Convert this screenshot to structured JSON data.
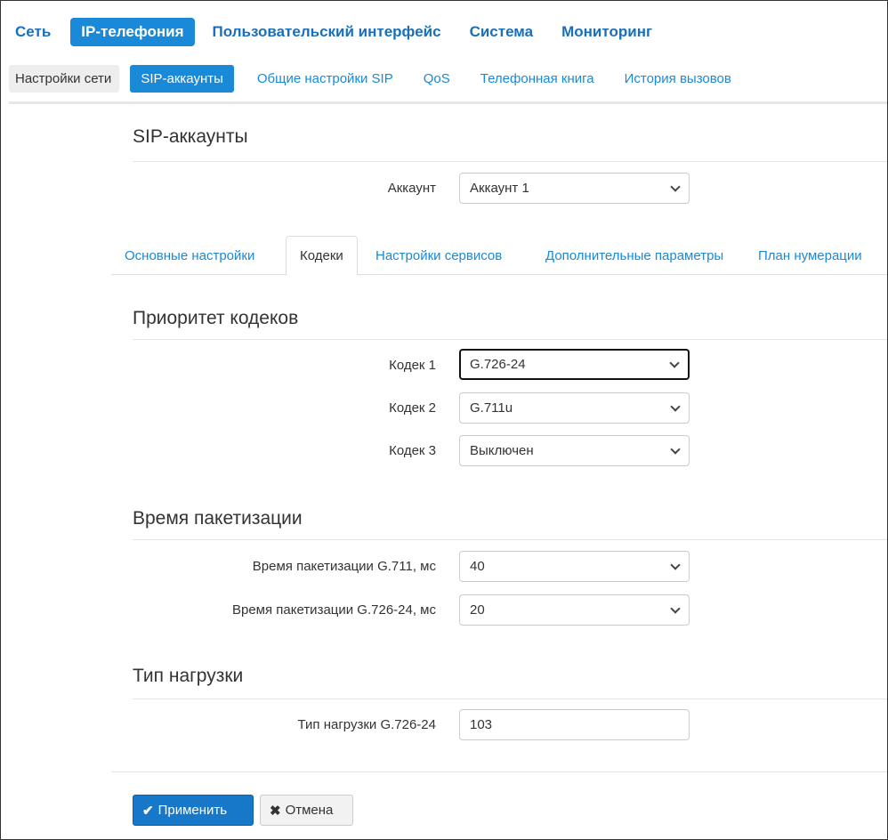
{
  "topnav": {
    "items": [
      {
        "label": "Сеть",
        "active": false
      },
      {
        "label": "IP-телефония",
        "active": true
      },
      {
        "label": "Пользовательский интерфейс",
        "active": false
      },
      {
        "label": "Система",
        "active": false
      },
      {
        "label": "Мониторинг",
        "active": false
      }
    ]
  },
  "subnav": {
    "items": [
      {
        "label": "Настройки сети"
      },
      {
        "label": "SIP-аккаунты",
        "active": true
      },
      {
        "label": "Общие настройки SIP"
      },
      {
        "label": "QoS"
      },
      {
        "label": "Телефонная книга"
      },
      {
        "label": "История вызовов"
      }
    ]
  },
  "page": {
    "title": "SIP-аккаунты",
    "account": {
      "label": "Аккаунт",
      "value": "Аккаунт 1"
    }
  },
  "tabs": [
    {
      "label": "Основные настройки"
    },
    {
      "label": "Кодеки",
      "active": true
    },
    {
      "label": "Настройки сервисов"
    },
    {
      "label": "Дополнительные параметры"
    },
    {
      "label": "План нумерации"
    }
  ],
  "codec_priority": {
    "title": "Приоритет кодеков",
    "codecs": [
      {
        "label": "Кодек 1",
        "value": "G.726-24"
      },
      {
        "label": "Кодек 2",
        "value": "G.711u"
      },
      {
        "label": "Кодек 3",
        "value": "Выключен"
      }
    ]
  },
  "packetization": {
    "title": "Время пакетизации",
    "g711": {
      "label": "Время пакетизации G.711, мс",
      "value": "40"
    },
    "g726": {
      "label": "Время пакетизации G.726-24, мс",
      "value": "20"
    }
  },
  "payload": {
    "title": "Тип нагрузки",
    "g726": {
      "label": "Тип нагрузки G.726-24",
      "value": "103"
    }
  },
  "buttons": {
    "apply_icon": "✔",
    "apply_label": "Применить",
    "cancel_icon": "✖",
    "cancel_label": "Отмена"
  },
  "colors": {
    "accent": "#1a8ad8",
    "apply_button": "#1777c9"
  }
}
